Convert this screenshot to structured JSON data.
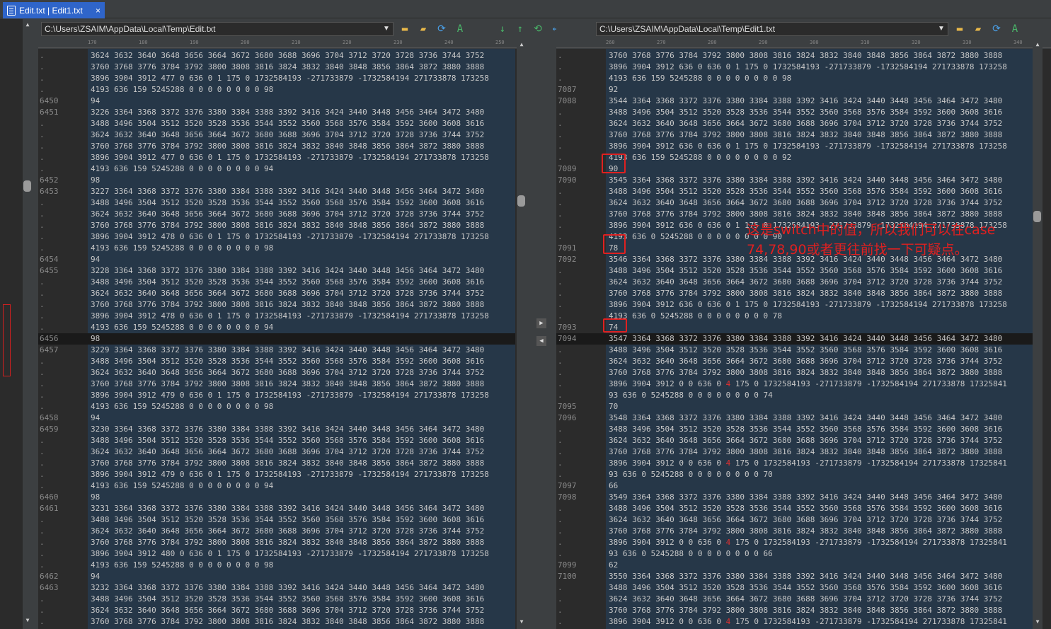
{
  "tab": {
    "title": "Edit.txt | Edit1.txt",
    "close": "×"
  },
  "left": {
    "path": "C:\\Users\\ZSAIM\\AppData\\Local\\Temp\\Edit.txt",
    "ruler": [
      "170",
      "180",
      "190",
      "200",
      "210",
      "220",
      "230",
      "240",
      "250"
    ],
    "lines": [
      {
        "n": ".",
        "t": "3624 3632 3640 3648 3656 3664 3672 3680 3688 3696 3704 3712 3720 3728 3736 3744 3752"
      },
      {
        "n": ".",
        "t": "3760 3768 3776 3784 3792 3800 3808 3816 3824 3832 3840 3848 3856 3864 3872 3880 3888"
      },
      {
        "n": ".",
        "t": "3896 3904 3912 477 0 636 0 1 175 0 1732584193 -271733879 -1732584194 271733878 173258"
      },
      {
        "n": ".",
        "t": "4193 636 159 5245288 0 0 0 0 0 0 0 0 98"
      },
      {
        "n": "6450",
        "t": "94"
      },
      {
        "n": "6451",
        "t": "3226 3364 3368 3372 3376 3380 3384 3388 3392 3416 3424 3440 3448 3456 3464 3472 3480"
      },
      {
        "n": ".",
        "t": "3488 3496 3504 3512 3520 3528 3536 3544 3552 3560 3568 3576 3584 3592 3600 3608 3616"
      },
      {
        "n": ".",
        "t": "3624 3632 3640 3648 3656 3664 3672 3680 3688 3696 3704 3712 3720 3728 3736 3744 3752"
      },
      {
        "n": ".",
        "t": "3760 3768 3776 3784 3792 3800 3808 3816 3824 3832 3840 3848 3856 3864 3872 3880 3888"
      },
      {
        "n": ".",
        "t": "3896 3904 3912 477 0 636 0 1 175 0 1732584193 -271733879 -1732584194 271733878 173258"
      },
      {
        "n": ".",
        "t": "4193 636 159 5245288 0 0 0 0 0 0 0 0 94"
      },
      {
        "n": "6452",
        "t": "98"
      },
      {
        "n": "6453",
        "t": "3227 3364 3368 3372 3376 3380 3384 3388 3392 3416 3424 3440 3448 3456 3464 3472 3480"
      },
      {
        "n": ".",
        "t": "3488 3496 3504 3512 3520 3528 3536 3544 3552 3560 3568 3576 3584 3592 3600 3608 3616"
      },
      {
        "n": ".",
        "t": "3624 3632 3640 3648 3656 3664 3672 3680 3688 3696 3704 3712 3720 3728 3736 3744 3752"
      },
      {
        "n": ".",
        "t": "3760 3768 3776 3784 3792 3800 3808 3816 3824 3832 3840 3848 3856 3864 3872 3880 3888"
      },
      {
        "n": ".",
        "t": "3896 3904 3912 478 0 636 0 1 175 0 1732584193 -271733879 -1732584194 271733878 173258"
      },
      {
        "n": ".",
        "t": "4193 636 159 5245288 0 0 0 0 0 0 0 0 98"
      },
      {
        "n": "6454",
        "t": "94"
      },
      {
        "n": "6455",
        "t": "3228 3364 3368 3372 3376 3380 3384 3388 3392 3416 3424 3440 3448 3456 3464 3472 3480"
      },
      {
        "n": ".",
        "t": "3488 3496 3504 3512 3520 3528 3536 3544 3552 3560 3568 3576 3584 3592 3600 3608 3616"
      },
      {
        "n": ".",
        "t": "3624 3632 3640 3648 3656 3664 3672 3680 3688 3696 3704 3712 3720 3728 3736 3744 3752"
      },
      {
        "n": ".",
        "t": "3760 3768 3776 3784 3792 3800 3808 3816 3824 3832 3840 3848 3856 3864 3872 3880 3888"
      },
      {
        "n": ".",
        "t": "3896 3904 3912 478 0 636 0 1 175 0 1732584193 -271733879 -1732584194 271733878 173258"
      },
      {
        "n": ".",
        "t": "4193 636 159 5245288 0 0 0 0 0 0 0 0 94"
      },
      {
        "n": "6456",
        "t": "98",
        "cur": true
      },
      {
        "n": "6457",
        "t": "3229 3364 3368 3372 3376 3380 3384 3388 3392 3416 3424 3440 3448 3456 3464 3472 3480"
      },
      {
        "n": ".",
        "t": "3488 3496 3504 3512 3520 3528 3536 3544 3552 3560 3568 3576 3584 3592 3600 3608 3616"
      },
      {
        "n": ".",
        "t": "3624 3632 3640 3648 3656 3664 3672 3680 3688 3696 3704 3712 3720 3728 3736 3744 3752"
      },
      {
        "n": ".",
        "t": "3760 3768 3776 3784 3792 3800 3808 3816 3824 3832 3840 3848 3856 3864 3872 3880 3888"
      },
      {
        "n": ".",
        "t": "3896 3904 3912 479 0 636 0 1 175 0 1732584193 -271733879 -1732584194 271733878 173258"
      },
      {
        "n": ".",
        "t": "4193 636 159 5245288 0 0 0 0 0 0 0 0 98"
      },
      {
        "n": "6458",
        "t": "94"
      },
      {
        "n": "6459",
        "t": "3230 3364 3368 3372 3376 3380 3384 3388 3392 3416 3424 3440 3448 3456 3464 3472 3480"
      },
      {
        "n": ".",
        "t": "3488 3496 3504 3512 3520 3528 3536 3544 3552 3560 3568 3576 3584 3592 3600 3608 3616"
      },
      {
        "n": ".",
        "t": "3624 3632 3640 3648 3656 3664 3672 3680 3688 3696 3704 3712 3720 3728 3736 3744 3752"
      },
      {
        "n": ".",
        "t": "3760 3768 3776 3784 3792 3800 3808 3816 3824 3832 3840 3848 3856 3864 3872 3880 3888"
      },
      {
        "n": ".",
        "t": "3896 3904 3912 479 0 636 0 1 175 0 1732584193 -271733879 -1732584194 271733878 173258"
      },
      {
        "n": ".",
        "t": "4193 636 159 5245288 0 0 0 0 0 0 0 0 94"
      },
      {
        "n": "6460",
        "t": "98"
      },
      {
        "n": "6461",
        "t": "3231 3364 3368 3372 3376 3380 3384 3388 3392 3416 3424 3440 3448 3456 3464 3472 3480"
      },
      {
        "n": ".",
        "t": "3488 3496 3504 3512 3520 3528 3536 3544 3552 3560 3568 3576 3584 3592 3600 3608 3616"
      },
      {
        "n": ".",
        "t": "3624 3632 3640 3648 3656 3664 3672 3680 3688 3696 3704 3712 3720 3728 3736 3744 3752"
      },
      {
        "n": ".",
        "t": "3760 3768 3776 3784 3792 3800 3808 3816 3824 3832 3840 3848 3856 3864 3872 3880 3888"
      },
      {
        "n": ".",
        "t": "3896 3904 3912 480 0 636 0 1 175 0 1732584193 -271733879 -1732584194 271733878 173258"
      },
      {
        "n": ".",
        "t": "4193 636 159 5245288 0 0 0 0 0 0 0 0 98"
      },
      {
        "n": "6462",
        "t": "94"
      },
      {
        "n": "6463",
        "t": "3232 3364 3368 3372 3376 3380 3384 3388 3392 3416 3424 3440 3448 3456 3464 3472 3480"
      },
      {
        "n": ".",
        "t": "3488 3496 3504 3512 3520 3528 3536 3544 3552 3560 3568 3576 3584 3592 3600 3608 3616"
      },
      {
        "n": ".",
        "t": "3624 3632 3640 3648 3656 3664 3672 3680 3688 3696 3704 3712 3720 3728 3736 3744 3752"
      },
      {
        "n": ".",
        "t": "3760 3768 3776 3784 3792 3800 3808 3816 3824 3832 3840 3848 3856 3864 3872 3880 3888"
      }
    ]
  },
  "right": {
    "path": "C:\\Users\\ZSAIM\\AppData\\Local\\Temp\\Edit1.txt",
    "ruler": [
      "260",
      "270",
      "280",
      "290",
      "300",
      "310",
      "320",
      "330",
      "340"
    ],
    "lines": [
      {
        "n": ".",
        "t": "3760 3768 3776 3784 3792 3800 3808 3816 3824 3832 3840 3848 3856 3864 3872 3880 3888"
      },
      {
        "n": ".",
        "t": "3896 3904 3912 636 0 636 0 1 175 0 1732584193 -271733879 -1732584194 271733878 173258"
      },
      {
        "n": ".",
        "t": "4193 636 159 5245288 0 0 0 0 0 0 0 0 98"
      },
      {
        "n": "7087",
        "t": "92"
      },
      {
        "n": "7088",
        "t": "3544 3364 3368 3372 3376 3380 3384 3388 3392 3416 3424 3440 3448 3456 3464 3472 3480"
      },
      {
        "n": ".",
        "t": "3488 3496 3504 3512 3520 3528 3536 3544 3552 3560 3568 3576 3584 3592 3600 3608 3616"
      },
      {
        "n": ".",
        "t": "3624 3632 3640 3648 3656 3664 3672 3680 3688 3696 3704 3712 3720 3728 3736 3744 3752"
      },
      {
        "n": ".",
        "t": "3760 3768 3776 3784 3792 3800 3808 3816 3824 3832 3840 3848 3856 3864 3872 3880 3888"
      },
      {
        "n": ".",
        "t": "3896 3904 3912 636 0 636 0 1 175 0 1732584193 -271733879 -1732584194 271733878 173258"
      },
      {
        "n": ".",
        "t": "4193 636 159 5245288 0 0 0 0 0 0 0 0 92"
      },
      {
        "n": "7089",
        "t": "90"
      },
      {
        "n": "7090",
        "t": "3545 3364 3368 3372 3376 3380 3384 3388 3392 3416 3424 3440 3448 3456 3464 3472 3480"
      },
      {
        "n": ".",
        "t": "3488 3496 3504 3512 3520 3528 3536 3544 3552 3560 3568 3576 3584 3592 3600 3608 3616"
      },
      {
        "n": ".",
        "t": "3624 3632 3640 3648 3656 3664 3672 3680 3688 3696 3704 3712 3720 3728 3736 3744 3752"
      },
      {
        "n": ".",
        "t": "3760 3768 3776 3784 3792 3800 3808 3816 3824 3832 3840 3848 3856 3864 3872 3880 3888"
      },
      {
        "n": ".",
        "t": "3896 3904 3912 636 0 636 0 1 175 0 1732584193 -271733879 -1732584194 271733878 173258"
      },
      {
        "n": ".",
        "t": "4193 636 0 5245288 0 0 0 0 0 0 0 0 90"
      },
      {
        "n": "7091",
        "t": "78"
      },
      {
        "n": "7092",
        "t": "3546 3364 3368 3372 3376 3380 3384 3388 3392 3416 3424 3440 3448 3456 3464 3472 3480"
      },
      {
        "n": ".",
        "t": "3488 3496 3504 3512 3520 3528 3536 3544 3552 3560 3568 3576 3584 3592 3600 3608 3616"
      },
      {
        "n": ".",
        "t": "3624 3632 3640 3648 3656 3664 3672 3680 3688 3696 3704 3712 3720 3728 3736 3744 3752"
      },
      {
        "n": ".",
        "t": "3760 3768 3776 3784 3792 3800 3808 3816 3824 3832 3840 3848 3856 3864 3872 3880 3888"
      },
      {
        "n": ".",
        "t": "3896 3904 3912 636 0 636 0 1 175 0 1732584193 -271733879 -1732584194 271733878 173258"
      },
      {
        "n": ".",
        "t": "4193 636 0 5245288 0 0 0 0 0 0 0 0 78"
      },
      {
        "n": "7093",
        "t": "74"
      },
      {
        "n": "7094",
        "t": "3547 3364 3368 3372 3376 3380 3384 3388 3392 3416 3424 3440 3448 3456 3464 3472 3480",
        "cur": true
      },
      {
        "n": ".",
        "t": "3488 3496 3504 3512 3520 3528 3536 3544 3552 3560 3568 3576 3584 3592 3600 3608 3616"
      },
      {
        "n": ".",
        "t": "3624 3632 3640 3648 3656 3664 3672 3680 3688 3696 3704 3712 3720 3728 3736 3744 3752"
      },
      {
        "n": ".",
        "t": "3760 3768 3776 3784 3792 3800 3808 3816 3824 3832 3840 3848 3856 3864 3872 3880 3888"
      },
      {
        "n": ".",
        "t": "3896 3904 3912 0 0 636 0 ",
        "r": "4",
        "t2": " 175 0 1732584193 -271733879 -1732584194 271733878 17325841"
      },
      {
        "n": ".",
        "t": "93 636 0 5245288 0 0 0 0 0 0 0 0 74"
      },
      {
        "n": "7095",
        "t": "70"
      },
      {
        "n": "7096",
        "t": "3548 3364 3368 3372 3376 3380 3384 3388 3392 3416 3424 3440 3448 3456 3464 3472 3480"
      },
      {
        "n": ".",
        "t": "3488 3496 3504 3512 3520 3528 3536 3544 3552 3560 3568 3576 3584 3592 3600 3608 3616"
      },
      {
        "n": ".",
        "t": "3624 3632 3640 3648 3656 3664 3672 3680 3688 3696 3704 3712 3720 3728 3736 3744 3752"
      },
      {
        "n": ".",
        "t": "3760 3768 3776 3784 3792 3800 3808 3816 3824 3832 3840 3848 3856 3864 3872 3880 3888"
      },
      {
        "n": ".",
        "t": "3896 3904 3912 0 0 636 0 ",
        "r": "4",
        "t2": " 175 0 1732584193 -271733879 -1732584194 271733878 17325841"
      },
      {
        "n": ".",
        "t": "93 636 0 5245288 0 0 0 0 0 0 0 0 70"
      },
      {
        "n": "7097",
        "t": "66"
      },
      {
        "n": "7098",
        "t": "3549 3364 3368 3372 3376 3380 3384 3388 3392 3416 3424 3440 3448 3456 3464 3472 3480"
      },
      {
        "n": ".",
        "t": "3488 3496 3504 3512 3520 3528 3536 3544 3552 3560 3568 3576 3584 3592 3600 3608 3616"
      },
      {
        "n": ".",
        "t": "3624 3632 3640 3648 3656 3664 3672 3680 3688 3696 3704 3712 3720 3728 3736 3744 3752"
      },
      {
        "n": ".",
        "t": "3760 3768 3776 3784 3792 3800 3808 3816 3824 3832 3840 3848 3856 3864 3872 3880 3888"
      },
      {
        "n": ".",
        "t": "3896 3904 3912 0 0 636 0 ",
        "r": "4",
        "t2": " 175 0 1732584193 -271733879 -1732584194 271733878 17325841"
      },
      {
        "n": ".",
        "t": "93 636 0 5245288 0 0 0 0 0 0 0 0 66"
      },
      {
        "n": "7099",
        "t": "62"
      },
      {
        "n": "7100",
        "t": "3550 3364 3368 3372 3376 3380 3384 3388 3392 3416 3424 3440 3448 3456 3464 3472 3480"
      },
      {
        "n": ".",
        "t": "3488 3496 3504 3512 3520 3528 3536 3544 3552 3560 3568 3576 3584 3592 3600 3608 3616"
      },
      {
        "n": ".",
        "t": "3624 3632 3640 3648 3656 3664 3672 3680 3688 3696 3704 3712 3720 3728 3736 3744 3752"
      },
      {
        "n": ".",
        "t": "3760 3768 3776 3784 3792 3800 3808 3816 3824 3832 3840 3848 3856 3864 3872 3880 3888"
      },
      {
        "n": ".",
        "t": "3896 3904 3912 0 0 636 0 ",
        "r": "4",
        "t2": " 175 0 1732584193 -271733879 -1732584194 271733878 17325841"
      }
    ]
  },
  "annotation": {
    "line1": "这是switch中的值，所以我们可以在case",
    "line2": "74,78,90或者更往前找一下可疑点。"
  },
  "colors": {
    "accent": "#2f65ca",
    "editor_bg": "#263748",
    "annotation": "#e02020"
  }
}
